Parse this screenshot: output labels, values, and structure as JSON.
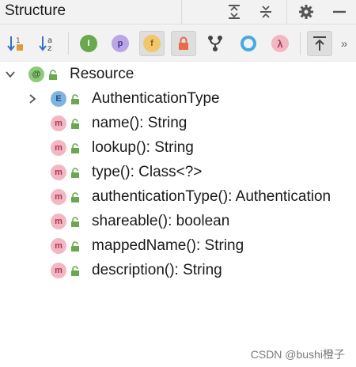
{
  "header": {
    "title": "Structure"
  },
  "toolbar": {
    "buttons": [
      {
        "name": "sort-by-visibility"
      },
      {
        "name": "sort-alphabetically"
      },
      {
        "name": "show-inherited",
        "glyph": "I"
      },
      {
        "name": "show-properties",
        "glyph": "p"
      },
      {
        "name": "show-fields",
        "glyph": "f"
      },
      {
        "name": "show-non-public"
      },
      {
        "name": "show-lambdas"
      },
      {
        "name": "show-anonymous"
      },
      {
        "name": "show-lambda",
        "glyph": "λ"
      },
      {
        "name": "autoscroll-from-source"
      },
      {
        "name": "more",
        "glyph": "»"
      }
    ]
  },
  "tree": {
    "root": {
      "icon_glyph": "@",
      "label": "Resource"
    },
    "enum_item": {
      "icon_glyph": "E",
      "label": "AuthenticationType"
    },
    "members": [
      {
        "icon_glyph": "m",
        "label": "name(): String"
      },
      {
        "icon_glyph": "m",
        "label": "lookup(): String"
      },
      {
        "icon_glyph": "m",
        "label": "type(): Class<?>"
      },
      {
        "icon_glyph": "m",
        "label": "authenticationType(): Authentication"
      },
      {
        "icon_glyph": "m",
        "label": "shareable(): boolean"
      },
      {
        "icon_glyph": "m",
        "label": "mappedName(): String"
      },
      {
        "icon_glyph": "m",
        "label": "description(): String"
      }
    ]
  },
  "watermark": "CSDN @bushi橙子",
  "colors": {
    "accent_green": "#6aa84f",
    "method_pink": "#f4b6c2",
    "enum_blue": "#7fb3e0",
    "annotation_green": "#8fca7a"
  }
}
